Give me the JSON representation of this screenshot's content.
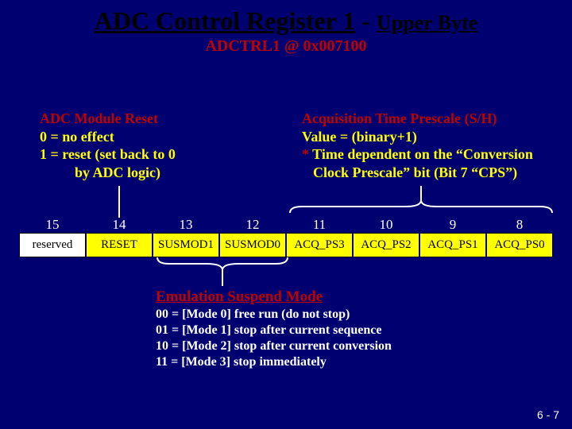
{
  "title": {
    "main": "ADC Control Register 1",
    "dash": " - ",
    "sub": "Upper Byte",
    "reg": "ADCTRL1 @ 0x007100"
  },
  "left": {
    "heading": "ADC Module Reset",
    "l1": "0 = no effect",
    "l2": "1 = reset (set back to 0",
    "l3": "by ADC logic)"
  },
  "right": {
    "heading": "Acquisition Time Prescale (S/H)",
    "l1": "Value = (binary+1)",
    "star": "*",
    "l2a": " Time dependent on the “Conversion",
    "l2b": "Clock Prescale” bit (Bit 7 “CPS”)"
  },
  "bits": {
    "nums": [
      "15",
      "14",
      "13",
      "12",
      "11",
      "10",
      "9",
      "8"
    ],
    "cells": [
      "reserved",
      "RESET",
      "SUSMOD1",
      "SUSMOD0",
      "ACQ_PS3",
      "ACQ_PS2",
      "ACQ_PS1",
      "ACQ_PS0"
    ]
  },
  "emul": {
    "heading": "Emulation Suspend Mode",
    "l1": "00 = [Mode 0] free run (do not stop)",
    "l2": "01 = [Mode 1] stop after current sequence",
    "l3": "10 = [Mode 2] stop after current conversion",
    "l4": "11 = [Mode 3] stop immediately"
  },
  "pagenum": "6 - 7"
}
